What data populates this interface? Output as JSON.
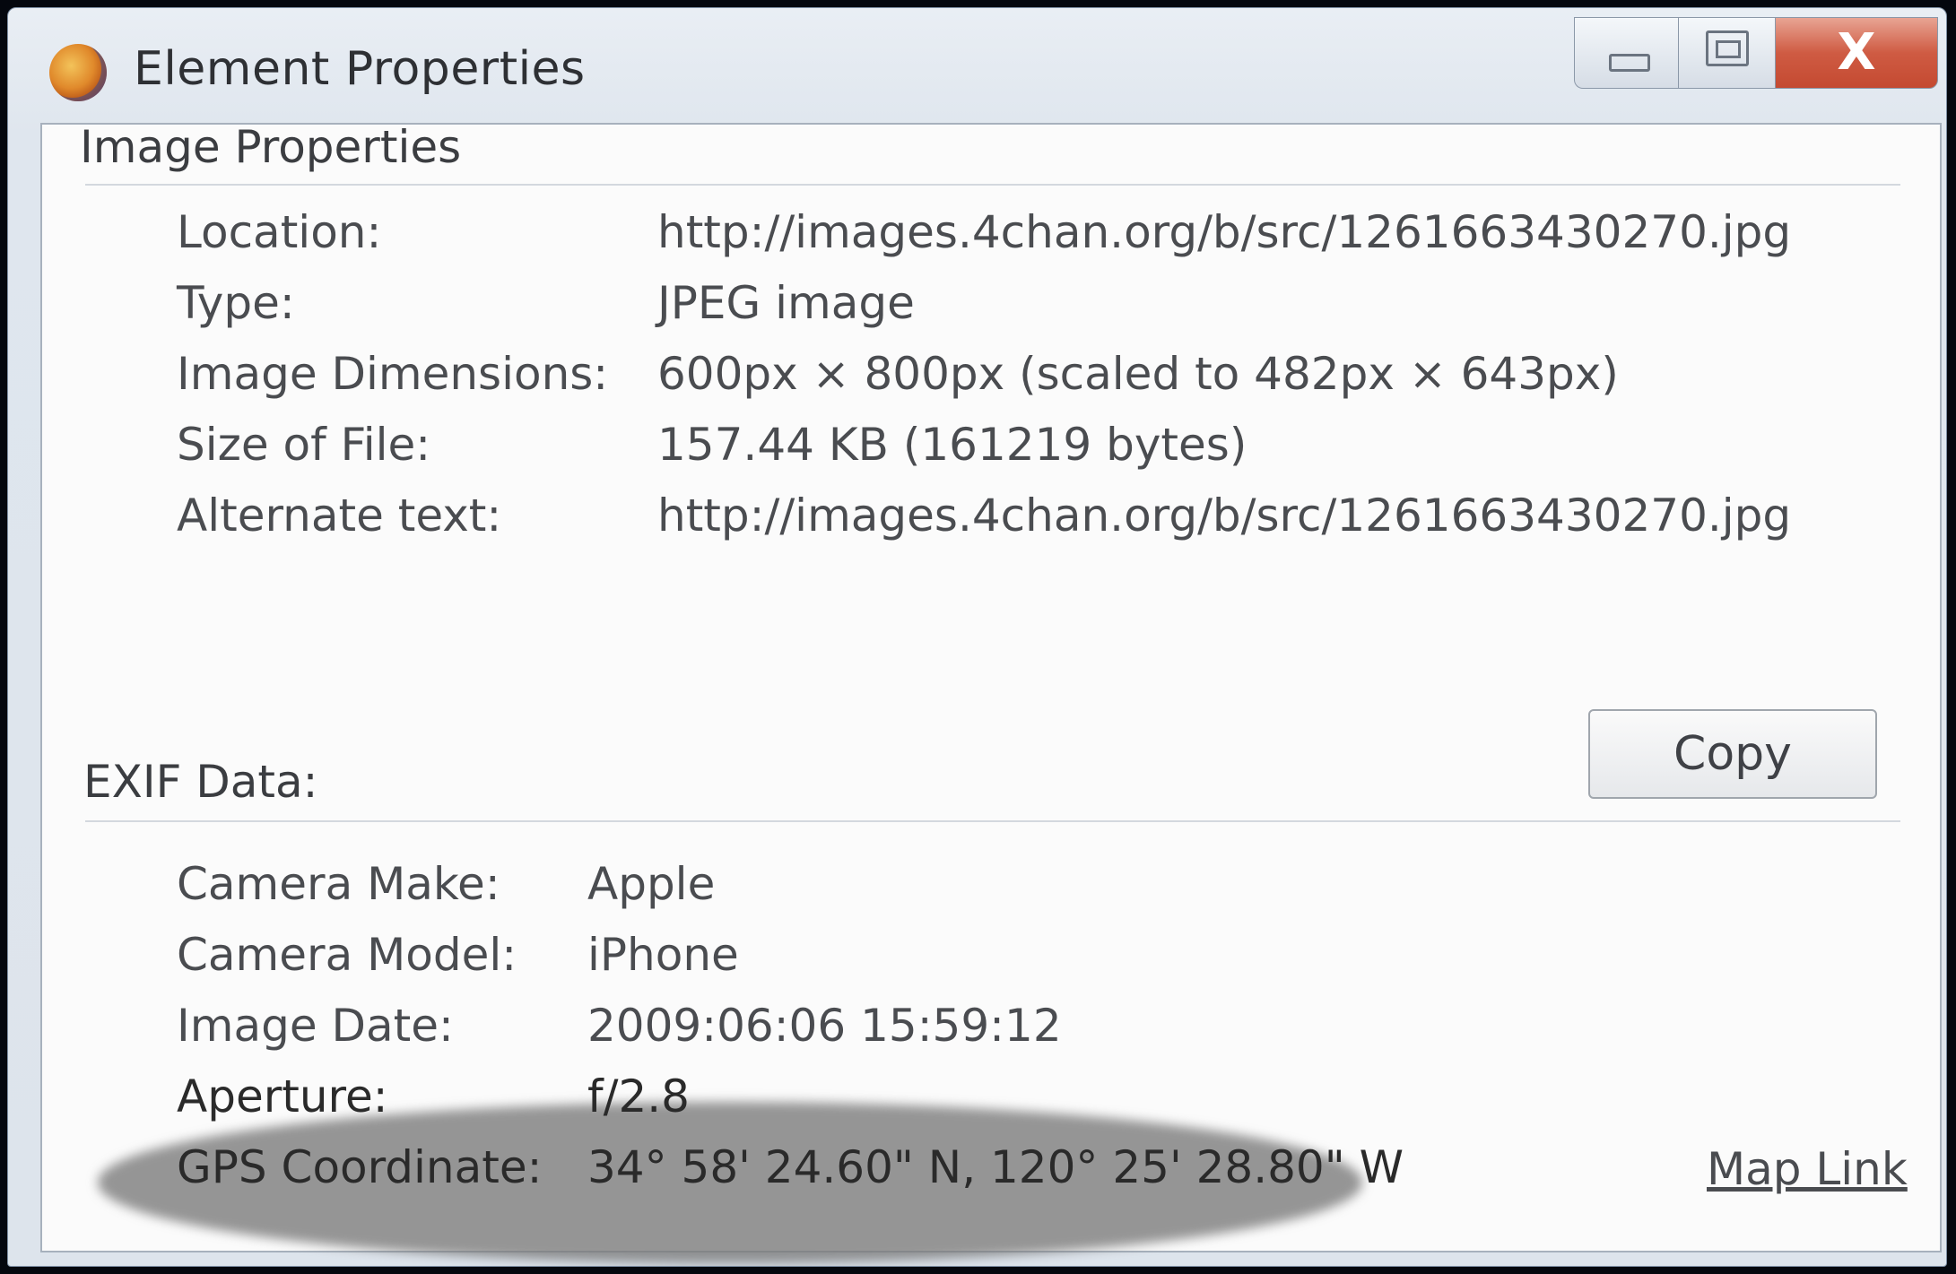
{
  "window": {
    "title": "Element Properties",
    "icon": "firefox-icon",
    "close_glyph": "X"
  },
  "image_properties": {
    "heading": "Image Properties",
    "rows": [
      {
        "label": "Location:",
        "value": "http://images.4chan.org/b/src/1261663430270.jpg"
      },
      {
        "label": "Type:",
        "value": "JPEG image"
      },
      {
        "label": "Image Dimensions:",
        "value": "600px × 800px (scaled to 482px × 643px)"
      },
      {
        "label": "Size of File:",
        "value": "157.44 KB (161219 bytes)"
      },
      {
        "label": "Alternate text:",
        "value": "http://images.4chan.org/b/src/1261663430270.jpg"
      }
    ]
  },
  "exif": {
    "heading": "EXIF Data:",
    "copy_label": "Copy",
    "rows": [
      {
        "label": "Camera Make:",
        "value": "Apple"
      },
      {
        "label": "Camera Model:",
        "value": "iPhone"
      },
      {
        "label": "Image Date:",
        "value": "2009:06:06 15:59:12"
      },
      {
        "label": "Aperture:",
        "value": "f/2.8"
      },
      {
        "label": "GPS Coordinate:",
        "value": "34° 58' 24.60\" N, 120° 25' 28.80\" W"
      }
    ],
    "map_link": "Map Link"
  },
  "colors": {
    "close_button": "#cf5b43",
    "highlight": "#787878"
  }
}
